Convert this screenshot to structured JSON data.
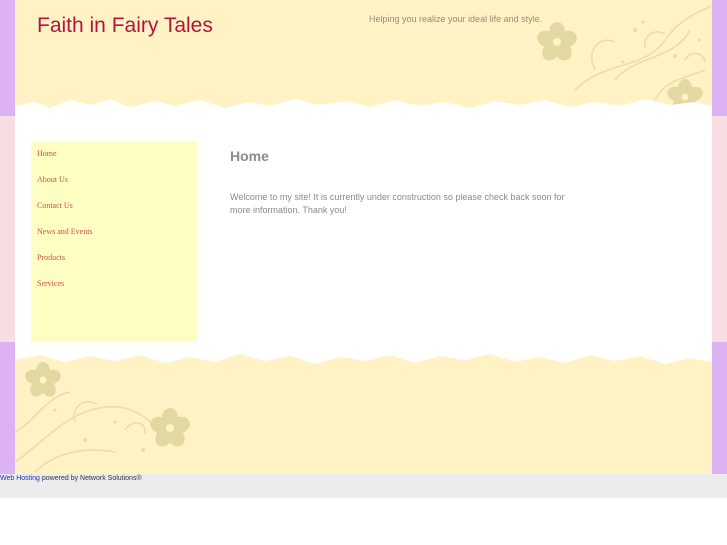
{
  "colors": {
    "side_band": "#dcb2f2",
    "side_band_middle": "#f8dde3",
    "header_cream": "#fff2c4",
    "sidebar_yellow": "#ffffc4",
    "title_red": "#b3153e",
    "nav_link": "#d84a4a",
    "flower": "#e2d8a2"
  },
  "header": {
    "site_title": "Faith in Fairy Tales",
    "tagline": "Helping you realize your ideal life and style."
  },
  "sidebar": {
    "items": [
      {
        "label": "Home"
      },
      {
        "label": "About Us"
      },
      {
        "label": "Contact Us"
      },
      {
        "label": "News and Events"
      },
      {
        "label": "Products"
      },
      {
        "label": "Services"
      }
    ]
  },
  "main": {
    "title": "Home",
    "body": "Welcome to my site! It is currently under construction so please check back soon for more information. Thank you!"
  },
  "footer": {
    "link_label": "Web Hosting",
    "suffix": " powered by Network Solutions®"
  },
  "icons": {
    "flower": "flower-icon",
    "swirl": "floral-swirl"
  }
}
